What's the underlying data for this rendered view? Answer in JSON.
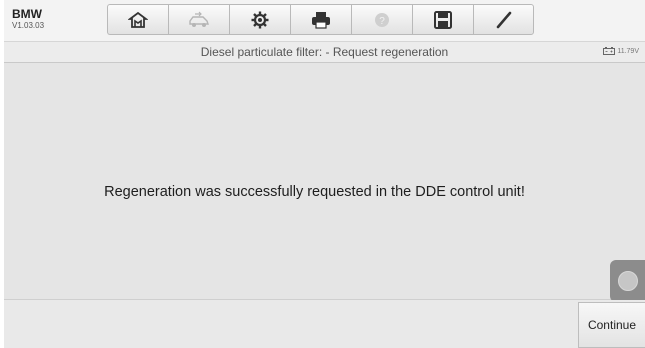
{
  "app": {
    "brand": "BMW",
    "version": "V1.03.03"
  },
  "toolbar": {
    "buttons": [
      {
        "icon": "home-icon",
        "enabled": true
      },
      {
        "icon": "vehicle-swap-icon",
        "enabled": false
      },
      {
        "icon": "settings-gear-icon",
        "enabled": true
      },
      {
        "icon": "print-icon",
        "enabled": true
      },
      {
        "icon": "help-icon",
        "enabled": false
      },
      {
        "icon": "save-icon",
        "enabled": true
      },
      {
        "icon": "edit-pen-icon",
        "enabled": true
      }
    ]
  },
  "header": {
    "title": "Diesel particulate filter: - Request regeneration"
  },
  "status": {
    "battery_voltage": "11.79V"
  },
  "main": {
    "message": "Regeneration was successfully requested in the DDE control unit!"
  },
  "footer": {
    "continue_label": "Continue"
  },
  "colors": {
    "content_bg": "#e5e5e5",
    "toolbar_bg": "#f3f3f3",
    "floating_button": "#8c8c8c"
  }
}
